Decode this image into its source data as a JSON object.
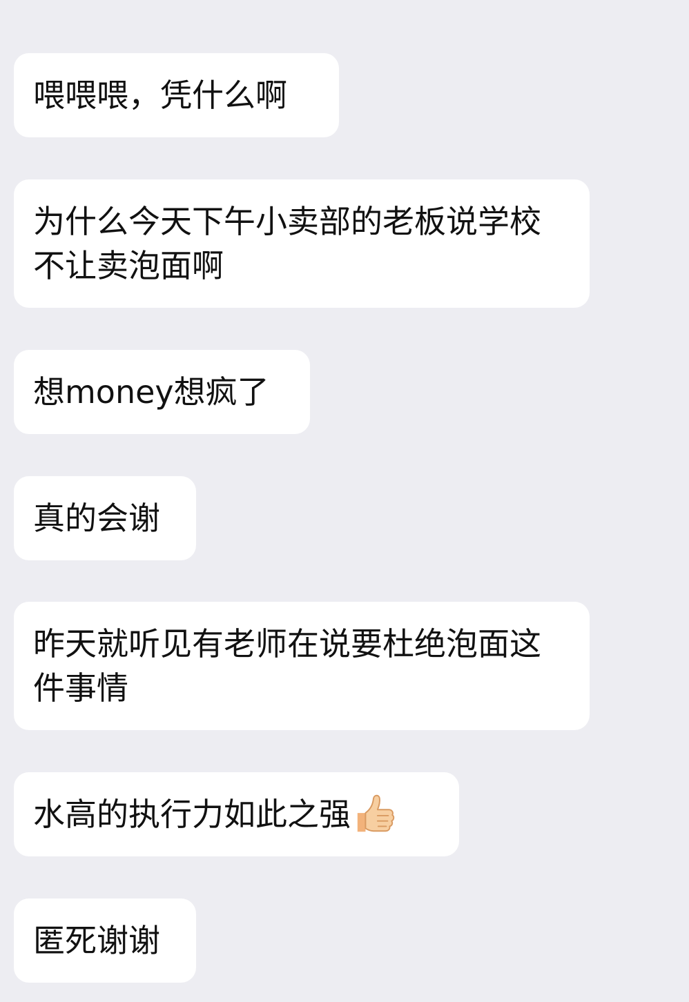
{
  "messages": [
    {
      "text": "喂喂喂，凭什么啊"
    },
    {
      "text": "为什么今天下午小卖部的老板说学校不让卖泡面啊"
    },
    {
      "text": "想money想疯了"
    },
    {
      "text": "真的会谢"
    },
    {
      "text": "昨天就听见有老师在说要杜绝泡面这件事情"
    },
    {
      "text": "水高的执行力如此之强",
      "emoji": "thumbs-up-icon"
    },
    {
      "text": "匿死谢谢"
    }
  ],
  "colors": {
    "background": "#EDEDF2",
    "bubble": "#FFFFFF",
    "text": "#111111"
  }
}
